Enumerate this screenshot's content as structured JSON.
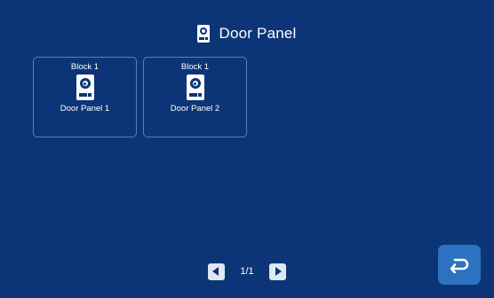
{
  "header": {
    "title": "Door Panel",
    "icon": "door-panel-icon"
  },
  "tiles": [
    {
      "block": "Block 1",
      "name": "Door Panel 1",
      "icon": "door-panel-icon"
    },
    {
      "block": "Block 1",
      "name": "Door Panel 2",
      "icon": "door-panel-icon"
    }
  ],
  "pager": {
    "indicator": "1/1",
    "prev_icon": "arrow-left-icon",
    "next_icon": "arrow-right-icon"
  },
  "back": {
    "icon": "return-icon"
  },
  "colors": {
    "background": "#0c3577",
    "tile_border": "#5b7fb5",
    "back_button": "#2c72c1"
  }
}
